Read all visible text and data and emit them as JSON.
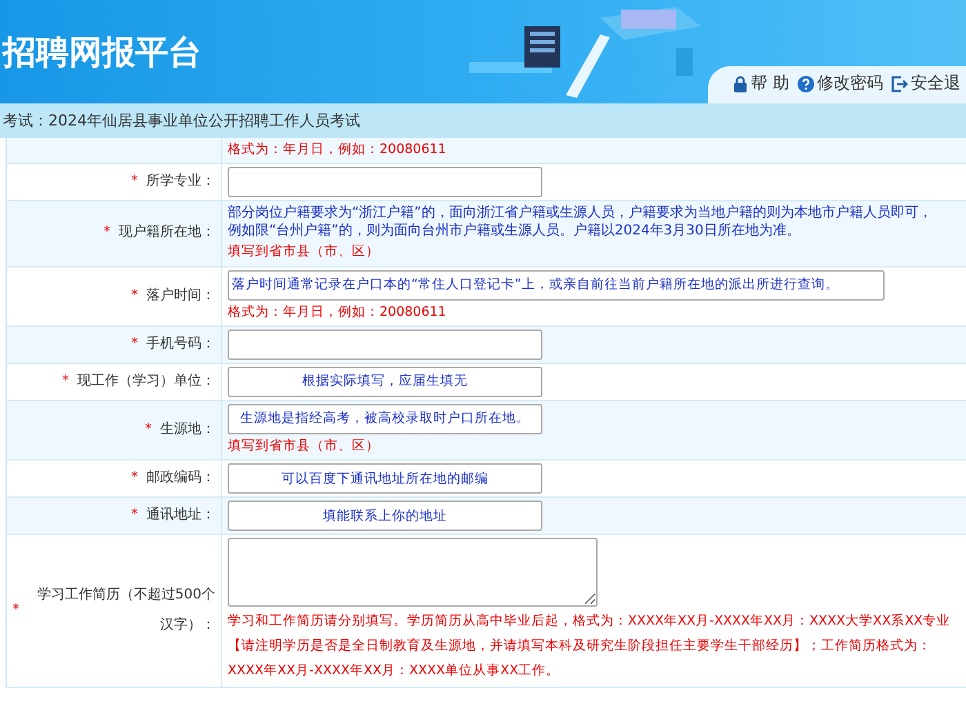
{
  "header": {
    "title": "招聘网报平台",
    "links": [
      {
        "kind": "lock",
        "label": "帮 助"
      },
      {
        "kind": "help",
        "label": "修改密码"
      },
      {
        "kind": "exit",
        "label": "安全退"
      }
    ]
  },
  "breadcrumb": "考试：2024年仙居县事业单位公开招聘工作人员考试",
  "rows": [
    {
      "hint": "格式为：年月日，例如：20080611"
    },
    {
      "label": "所学专业：",
      "required_mark": "*",
      "field": {
        "kind": "input"
      }
    },
    {
      "label": "现户籍所在地：",
      "required_mark": "*",
      "note": "部分岗位户籍要求为“浙江户籍”的，面向浙江省户籍或生源人员，户籍要求为当地户籍的则为本地市户籍人员即可，例如限“台州户籍”的，则为面向台州市户籍或生源人员。户籍以2024年3月30日所在地为准。",
      "hint": "填写到省市县（市、区）"
    },
    {
      "label": "落户时间：",
      "required_mark": "*",
      "field": {
        "kind": "input",
        "value": "落户时间通常记录在户口本的“常住人口登记卡”上，或亲自前往当前户籍所在地的派出所进行查询。"
      },
      "hint": "格式为：年月日，例如：20080611"
    },
    {
      "label": "手机号码：",
      "required_mark": "*",
      "field": {
        "kind": "input"
      }
    },
    {
      "label": "现工作（学习）单位：",
      "required_mark": "*",
      "field": {
        "kind": "input",
        "value": "根据实际填写，应届生填无"
      }
    },
    {
      "label": "生源地：",
      "required_mark": "*",
      "field": {
        "kind": "input",
        "value": "生源地是指经高考，被高校录取时户口所在地。"
      },
      "hint": "填写到省市县（市、区）"
    },
    {
      "label": "邮政编码：",
      "required_mark": "*",
      "field": {
        "kind": "input",
        "value": "可以百度下通讯地址所在地的邮编"
      }
    },
    {
      "label": "通讯地址：",
      "required_mark": "*",
      "field": {
        "kind": "input",
        "value": "填能联系上你的地址"
      }
    },
    {
      "label": "学习工作简历（不超过500个汉字）：",
      "required_mark": "*",
      "field": {
        "kind": "textarea"
      },
      "hint": "学习和工作简历请分别填写。学历简历从高中毕业后起，格式为：XXXX年XX月-XXXX年XX月：XXXX大学XX系XX专业【请注明学历是否是全日制教育及生源地，并请填写本科及研究生阶段担任主要学生干部经历】；工作简历格式为：XXXX年XX月-XXXX年XX月：XXXX单位从事XX工作。"
    }
  ]
}
